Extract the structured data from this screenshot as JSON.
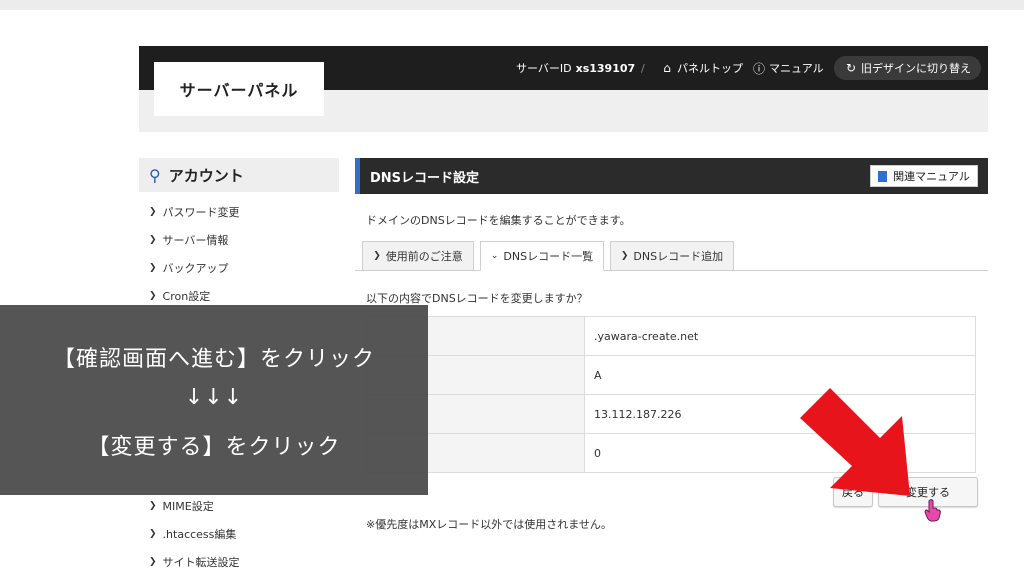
{
  "header": {
    "logo": "サーバーパネル",
    "server_id_label": "サーバーID",
    "server_id": "xs139107",
    "separator": "/",
    "panel_top": "パネルトップ",
    "manual": "マニュアル",
    "old_design": "旧デザインに切り替え"
  },
  "sidebar": {
    "title": "アカウント",
    "items": [
      {
        "label": "パスワード変更"
      },
      {
        "label": "サーバー情報"
      },
      {
        "label": "バックアップ"
      },
      {
        "label": "Cron設定"
      },
      {
        "label": "MIME設定"
      },
      {
        "label": ".htaccess編集"
      },
      {
        "label": "サイト転送設定"
      }
    ]
  },
  "main": {
    "title": "DNSレコード設定",
    "manual_button": "関連マニュアル",
    "description": "ドメインのDNSレコードを編集することができます。",
    "tabs": [
      {
        "label": "使用前のご注意",
        "active": false
      },
      {
        "label": "DNSレコード一覧",
        "active": true
      },
      {
        "label": "DNSレコード追加",
        "active": false
      }
    ],
    "confirm_text": "以下の内容でDNSレコードを変更しますか？",
    "records": [
      {
        "value": ".yawara-create.net"
      },
      {
        "value": "A"
      },
      {
        "value": "13.112.187.226"
      },
      {
        "value": "0"
      }
    ],
    "back_button": "戻る",
    "change_button": "変更する",
    "note": "※優先度はMXレコード以外では使用されません。"
  },
  "overlay": {
    "line1": "【確認画面へ進む】をクリック",
    "line2": "↓↓↓",
    "line3": "【変更する】をクリック"
  },
  "colors": {
    "accent_blue": "#2f6fce",
    "header_dark": "#1e1e1e",
    "arrow_red": "#e8141c"
  },
  "icons": {
    "panel_top": "home-icon",
    "manual": "help-circle-icon",
    "old_design": "refresh-icon",
    "sidebar_title": "person-icon",
    "manual_button": "book-icon",
    "annotation": "red-arrow",
    "cursor": "hand-pointer-icon"
  }
}
